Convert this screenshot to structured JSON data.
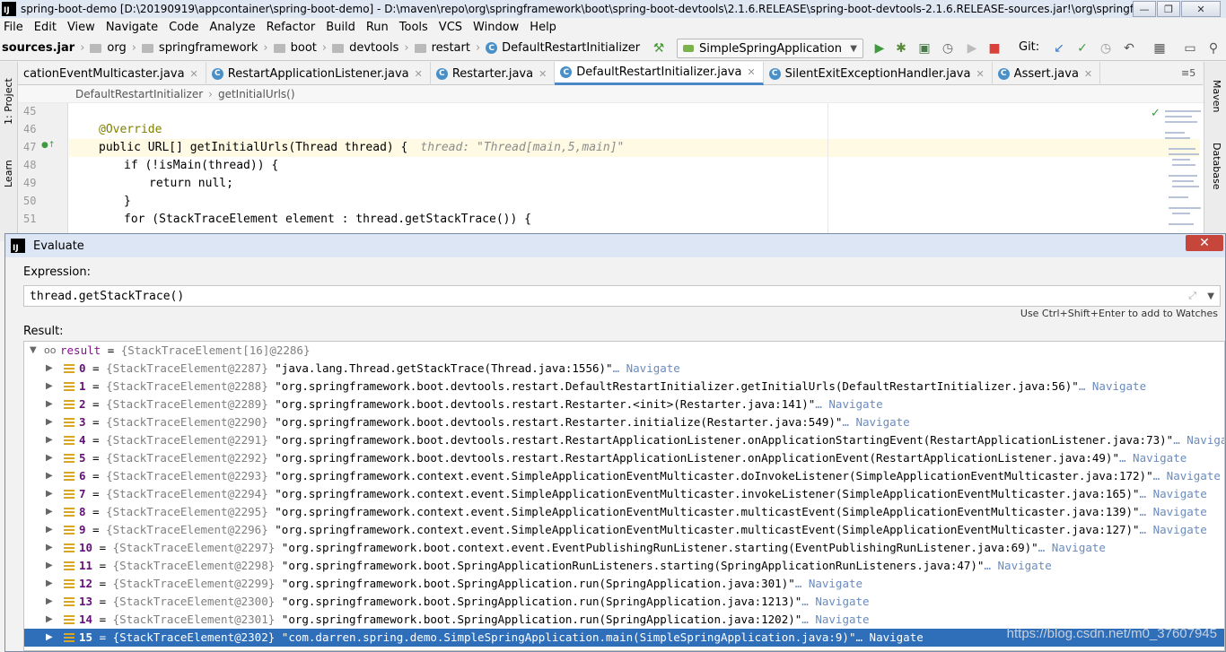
{
  "window": {
    "title": "spring-boot-demo [D:\\20190919\\appcontainer\\spring-boot-demo] - D:\\maven\\repo\\org\\springframework\\boot\\spring-boot-devtools\\2.1.6.RELEASE\\spring-boot-devtools-2.1.6.RELEASE-sources.jar!\\org\\springfra...",
    "logo": "IJ"
  },
  "menu": [
    "File",
    "Edit",
    "View",
    "Navigate",
    "Code",
    "Analyze",
    "Refactor",
    "Build",
    "Run",
    "Tools",
    "VCS",
    "Window",
    "Help"
  ],
  "navbar": {
    "crumbs": [
      "sources.jar",
      "org",
      "springframework",
      "boot",
      "devtools",
      "restart"
    ],
    "current_class": "DefaultRestartInitializer",
    "run_config": "SimpleSpringApplication",
    "git_label": "Git:"
  },
  "tabs": [
    {
      "label": "cationEventMulticaster.java",
      "active": false
    },
    {
      "label": "RestartApplicationListener.java",
      "active": false
    },
    {
      "label": "Restarter.java",
      "active": false
    },
    {
      "label": "DefaultRestartInitializer.java",
      "active": true
    },
    {
      "label": "SilentExitExceptionHandler.java",
      "active": false
    },
    {
      "label": "Assert.java",
      "active": false
    }
  ],
  "tab_overflow": "≡5",
  "side_tools": {
    "left": [
      "1: Project",
      "Learn"
    ],
    "right": [
      "Maven",
      "Database"
    ]
  },
  "editor": {
    "breadcrumb": [
      "DefaultRestartInitializer",
      "getInitialUrls()"
    ],
    "lines": [
      {
        "num": "45",
        "text": ""
      },
      {
        "num": "46",
        "text": "@Override"
      },
      {
        "num": "47",
        "text": "public URL[] getInitialUrls(Thread thread) {",
        "hint": "thread: \"Thread[main,5,main]\""
      },
      {
        "num": "48",
        "text": "if (!isMain(thread)) {"
      },
      {
        "num": "49",
        "text": "return null;"
      },
      {
        "num": "50",
        "text": "}"
      },
      {
        "num": "51",
        "text": "for (StackTraceElement element : thread.getStackTrace()) {"
      }
    ]
  },
  "evaluate": {
    "title": "Evaluate",
    "logo": "IJ",
    "expression_label": "Expression:",
    "expression": "thread.getStackTrace()",
    "watch_hint": "Use Ctrl+Shift+Enter to add to Watches",
    "result_label": "Result:",
    "result_root": {
      "name": "result",
      "value": "{StackTraceElement[16]@2286}"
    },
    "navigate_label": "Navigate",
    "items": [
      {
        "index": "0",
        "obj": "{StackTraceElement@2287}",
        "value": "\"java.lang.Thread.getStackTrace(Thread.java:1556)\""
      },
      {
        "index": "1",
        "obj": "{StackTraceElement@2288}",
        "value": "\"org.springframework.boot.devtools.restart.DefaultRestartInitializer.getInitialUrls(DefaultRestartInitializer.java:56)\""
      },
      {
        "index": "2",
        "obj": "{StackTraceElement@2289}",
        "value": "\"org.springframework.boot.devtools.restart.Restarter.<init>(Restarter.java:141)\""
      },
      {
        "index": "3",
        "obj": "{StackTraceElement@2290}",
        "value": "\"org.springframework.boot.devtools.restart.Restarter.initialize(Restarter.java:549)\""
      },
      {
        "index": "4",
        "obj": "{StackTraceElement@2291}",
        "value": "\"org.springframework.boot.devtools.restart.RestartApplicationListener.onApplicationStartingEvent(RestartApplicationListener.java:73)\""
      },
      {
        "index": "5",
        "obj": "{StackTraceElement@2292}",
        "value": "\"org.springframework.boot.devtools.restart.RestartApplicationListener.onApplicationEvent(RestartApplicationListener.java:49)\""
      },
      {
        "index": "6",
        "obj": "{StackTraceElement@2293}",
        "value": "\"org.springframework.context.event.SimpleApplicationEventMulticaster.doInvokeListener(SimpleApplicationEventMulticaster.java:172)\""
      },
      {
        "index": "7",
        "obj": "{StackTraceElement@2294}",
        "value": "\"org.springframework.context.event.SimpleApplicationEventMulticaster.invokeListener(SimpleApplicationEventMulticaster.java:165)\""
      },
      {
        "index": "8",
        "obj": "{StackTraceElement@2295}",
        "value": "\"org.springframework.context.event.SimpleApplicationEventMulticaster.multicastEvent(SimpleApplicationEventMulticaster.java:139)\""
      },
      {
        "index": "9",
        "obj": "{StackTraceElement@2296}",
        "value": "\"org.springframework.context.event.SimpleApplicationEventMulticaster.multicastEvent(SimpleApplicationEventMulticaster.java:127)\""
      },
      {
        "index": "10",
        "obj": "{StackTraceElement@2297}",
        "value": "\"org.springframework.boot.context.event.EventPublishingRunListener.starting(EventPublishingRunListener.java:69)\""
      },
      {
        "index": "11",
        "obj": "{StackTraceElement@2298}",
        "value": "\"org.springframework.boot.SpringApplicationRunListeners.starting(SpringApplicationRunListeners.java:47)\""
      },
      {
        "index": "12",
        "obj": "{StackTraceElement@2299}",
        "value": "\"org.springframework.boot.SpringApplication.run(SpringApplication.java:301)\""
      },
      {
        "index": "13",
        "obj": "{StackTraceElement@2300}",
        "value": "\"org.springframework.boot.SpringApplication.run(SpringApplication.java:1213)\""
      },
      {
        "index": "14",
        "obj": "{StackTraceElement@2301}",
        "value": "\"org.springframework.boot.SpringApplication.run(SpringApplication.java:1202)\""
      },
      {
        "index": "15",
        "obj": "{StackTraceElement@2302}",
        "value": "\"com.darren.spring.demo.SimpleSpringApplication.main(SimpleSpringApplication.java:9)\"",
        "selected": true
      }
    ]
  },
  "watermark": "https://blog.csdn.net/m0_37607945"
}
